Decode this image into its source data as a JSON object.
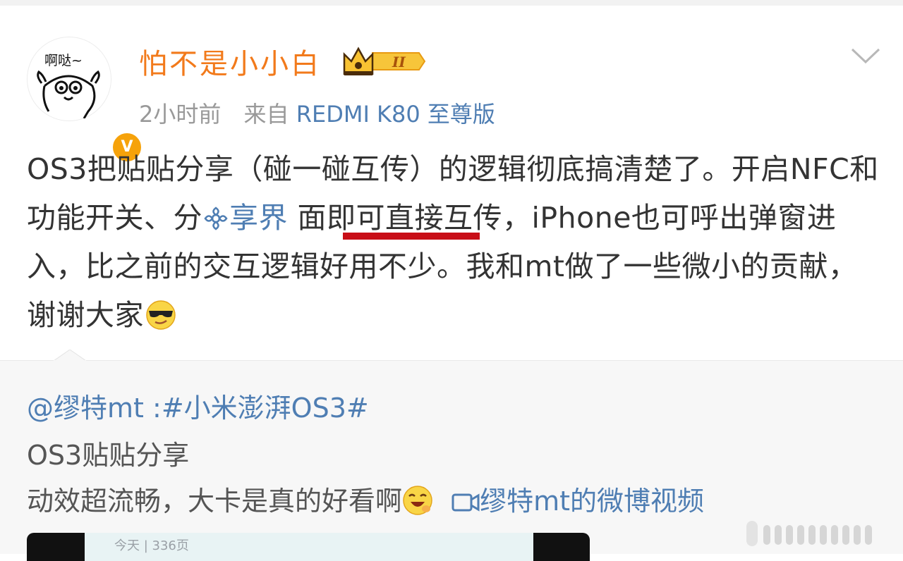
{
  "post": {
    "avatar_text": "啊哒~",
    "verified_badge": "V",
    "username": "怕不是小小白",
    "member_level": "II",
    "time": "2小时前",
    "from_label": "来自",
    "source": "REDMI K80 至尊版",
    "text_part1": "OS3把贴贴分享（碰一碰互传）的逻辑彻底搞清楚了。开启NFC和功能开关、分",
    "topic_link": "享界",
    "text_part2": " 面即可直接互传，iPhone也可呼出弹窗进入，比之前的交互逻辑好用不少。我和mt做了一些微小的贡献，谢谢大家"
  },
  "repost": {
    "author_mention": "@缪特mt",
    "separator": ":",
    "hashtag": "#小米澎湃OS3#",
    "line2": "OS3贴贴分享",
    "line3_text": "动效超流畅，大卡是真的好看啊",
    "video_link": "缪特mt的微博视频",
    "thumb_text": "今天 | 336页"
  },
  "colors": {
    "username": "#f27a1b",
    "link": "#4f7eb3",
    "underline": "#c80e17",
    "badge": "#f6a20a"
  },
  "icons": [
    "chevron-down-icon",
    "crown-member-icon",
    "verified-v-icon",
    "topic-flower-icon",
    "sunglasses-emoji-icon",
    "laugh-emoji-icon",
    "video-icon",
    "images-icon"
  ]
}
